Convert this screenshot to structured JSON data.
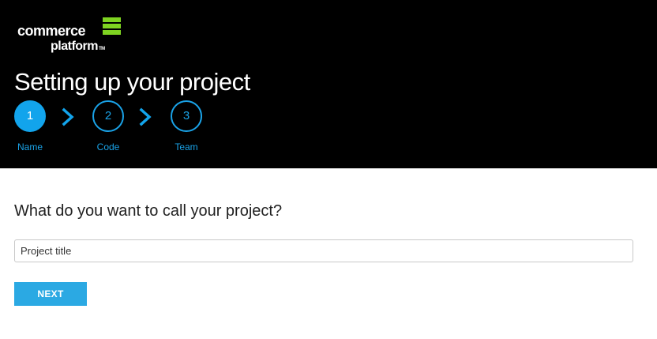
{
  "brand": {
    "line1": "commerce",
    "line2": "platform",
    "trademark": "TM",
    "accent_color": "#7ed321"
  },
  "header": {
    "title": "Setting up your project"
  },
  "steps": [
    {
      "number": "1",
      "label": "Name",
      "active": true
    },
    {
      "number": "2",
      "label": "Code",
      "active": false
    },
    {
      "number": "3",
      "label": "Team",
      "active": false
    }
  ],
  "form": {
    "question": "What do you want to call your project?",
    "title_placeholder": "Project title",
    "title_value": "",
    "next_label": "NEXT"
  },
  "colors": {
    "header_background": "#000000",
    "step_accent": "#12a4ec",
    "button": "#2ba9e3"
  },
  "icons": {
    "step_separator": "chevron-right-icon"
  }
}
